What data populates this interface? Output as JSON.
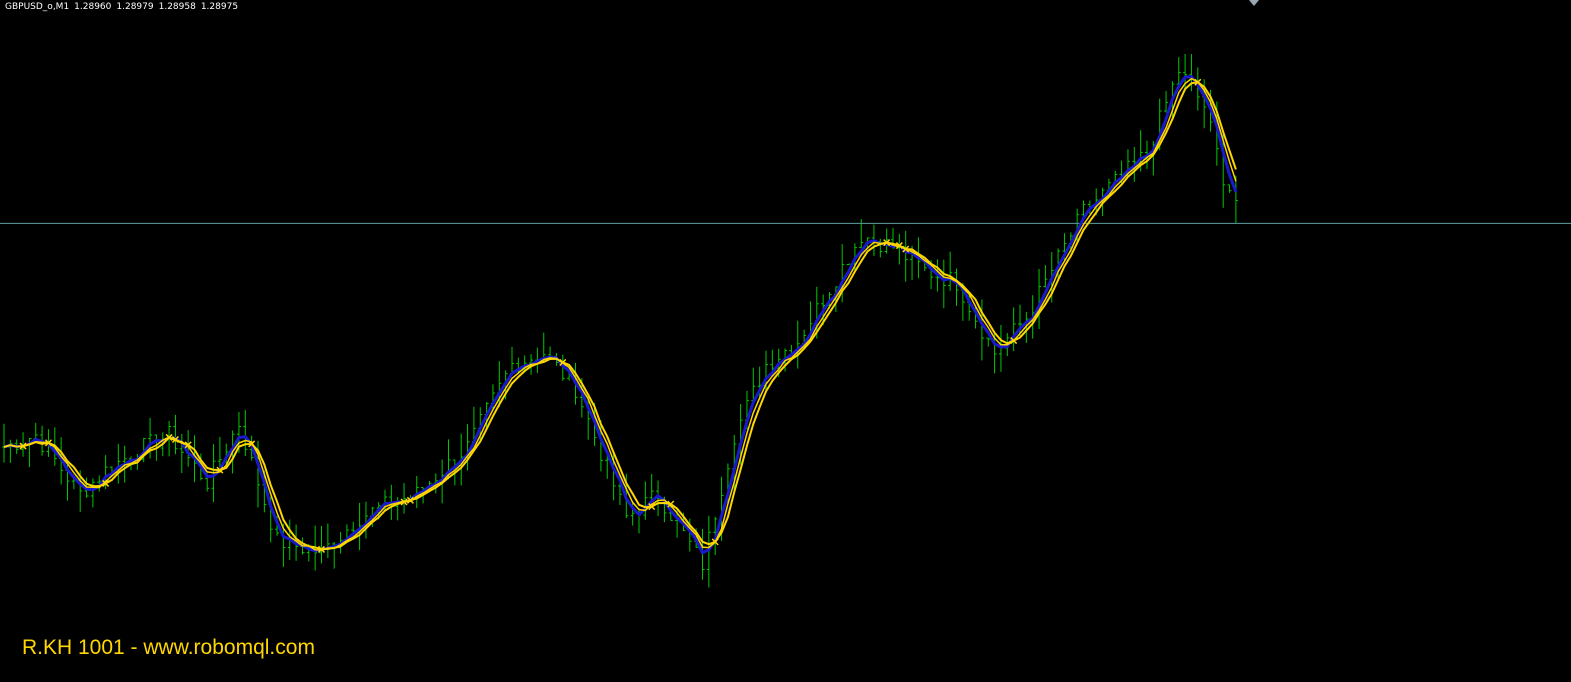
{
  "header": {
    "symbol": "GBPUSD_o,M1",
    "open": "1.28960",
    "high": "1.28979",
    "low": "1.28958",
    "close": "1.28975"
  },
  "watermark": "R.KH 1001 - www.robomql.com",
  "colors": {
    "background": "#000000",
    "bars": "#00c800",
    "ma_fast": "#ffd700",
    "ma_slow": "#1a1acd",
    "price_line": "#5f9ea0",
    "text": "#ffffff",
    "watermark": "#ffd700"
  },
  "chart_data": {
    "type": "line",
    "chart_kind": "OHLC bar chart with moving averages",
    "timeframe": "M1",
    "current_price": 1.28975,
    "grid": false,
    "x_axis_labels": false,
    "y_axis_labels": false,
    "bar_count": 195,
    "waypoints": [
      [
        0,
        1.2888
      ],
      [
        5,
        1.28885
      ],
      [
        12,
        1.2886
      ],
      [
        16,
        1.2887
      ],
      [
        22,
        1.2888
      ],
      [
        26,
        1.28885
      ],
      [
        32,
        1.28865
      ],
      [
        37,
        1.2889
      ],
      [
        43,
        1.2884
      ],
      [
        50,
        1.28835
      ],
      [
        56,
        1.2885
      ],
      [
        60,
        1.28855
      ],
      [
        65,
        1.2886
      ],
      [
        73,
        1.2888
      ],
      [
        80,
        1.28915
      ],
      [
        85,
        1.2892
      ],
      [
        90,
        1.28905
      ],
      [
        98,
        1.2885
      ],
      [
        103,
        1.2886
      ],
      [
        110,
        1.2883
      ],
      [
        115,
        1.28885
      ],
      [
        120,
        1.28915
      ],
      [
        125,
        1.28925
      ],
      [
        135,
        1.2897
      ],
      [
        140,
        1.28965
      ],
      [
        145,
        1.28955
      ],
      [
        150,
        1.2895
      ],
      [
        156,
        1.2892
      ],
      [
        161,
        1.28935
      ],
      [
        170,
        1.2898
      ],
      [
        180,
        1.29005
      ],
      [
        185,
        1.2904
      ],
      [
        189,
        1.29025
      ],
      [
        192,
        1.28995
      ],
      [
        194,
        1.28985
      ]
    ]
  }
}
